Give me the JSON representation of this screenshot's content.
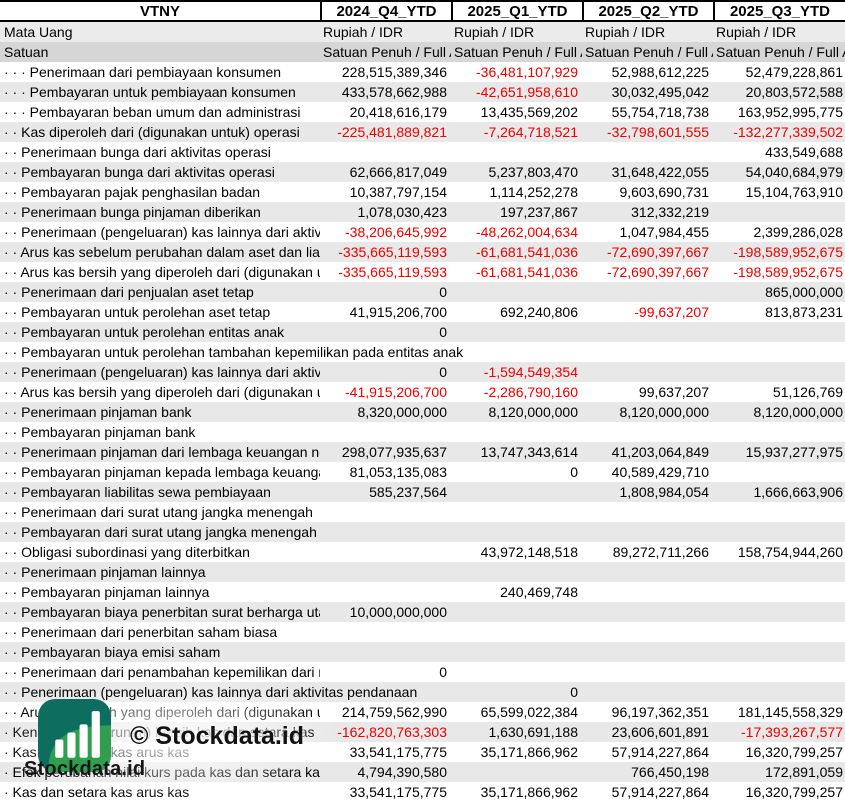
{
  "header": {
    "company": "VTNY",
    "periods": [
      "2024_Q4_YTD",
      "2025_Q1_YTD",
      "2025_Q2_YTD",
      "2025_Q3_YTD"
    ]
  },
  "meta_rows": [
    {
      "label": "Mata Uang",
      "values": [
        "Rupiah / IDR",
        "Rupiah / IDR",
        "Rupiah / IDR",
        "Rupiah / IDR"
      ],
      "style": "meta1"
    },
    {
      "label": "Satuan",
      "values": [
        "Satuan Penuh / Full A",
        "Satuan Penuh / Full A",
        "Satuan Penuh / Full A",
        "Satuan Penuh / Full A"
      ],
      "style": "meta2"
    }
  ],
  "rows": [
    {
      "label": "· · · Penerimaan dari pembiayaan konsumen",
      "values": [
        "228,515,389,346",
        "-36,481,107,929",
        "52,988,612,225",
        "52,479,228,861"
      ]
    },
    {
      "label": "· · · Pembayaran untuk pembiayaan konsumen",
      "values": [
        "433,578,662,988",
        "-42,651,958,610",
        "30,032,495,042",
        "20,803,572,588"
      ]
    },
    {
      "label": "· · · Pembayaran beban umum dan administrasi",
      "values": [
        "20,418,616,179",
        "13,435,569,202",
        "55,754,718,738",
        "163,952,995,775"
      ]
    },
    {
      "label": "· · Kas diperoleh dari (digunakan untuk) operasi",
      "values": [
        "-225,481,889,821",
        "-7,264,718,521",
        "-32,798,601,555",
        "-132,277,339,502"
      ]
    },
    {
      "label": "· · Penerimaan bunga dari aktivitas operasi",
      "values": [
        "",
        "",
        "",
        "433,549,688"
      ]
    },
    {
      "label": "· · Pembayaran bunga dari aktivitas operasi",
      "values": [
        "62,666,817,049",
        "5,237,803,470",
        "31,648,422,055",
        "54,040,684,979"
      ]
    },
    {
      "label": "· · Pembayaran pajak penghasilan badan",
      "values": [
        "10,387,797,154",
        "1,114,252,278",
        "9,603,690,731",
        "15,104,763,910"
      ]
    },
    {
      "label": "· · Penerimaan bunga pinjaman diberikan",
      "values": [
        "1,078,030,423",
        "197,237,867",
        "312,332,219",
        ""
      ]
    },
    {
      "label": "· · Penerimaan (pengeluaran) kas lainnya dari aktivit",
      "values": [
        "-38,206,645,992",
        "-48,262,004,634",
        "1,047,984,455",
        "2,399,286,028"
      ]
    },
    {
      "label": "· · Arus kas sebelum perubahan dalam aset dan liabi",
      "values": [
        "-335,665,119,593",
        "-61,681,541,036",
        "-72,690,397,667",
        "-198,589,952,675"
      ]
    },
    {
      "label": "· · Arus kas bersih yang diperoleh dari (digunakan ur",
      "values": [
        "-335,665,119,593",
        "-61,681,541,036",
        "-72,690,397,667",
        "-198,589,952,675"
      ]
    },
    {
      "label": "· · Penerimaan dari penjualan aset tetap",
      "values": [
        "0",
        "",
        "",
        "865,000,000"
      ]
    },
    {
      "label": "· · Pembayaran untuk perolehan aset tetap",
      "values": [
        "41,915,206,700",
        "692,240,806",
        "-99,637,207",
        "813,873,231"
      ]
    },
    {
      "label": "· · Pembayaran untuk perolehan entitas anak",
      "values": [
        "0",
        "",
        "",
        ""
      ]
    },
    {
      "label": "· · Pembayaran untuk perolehan tambahan kepemilikan pada entitas anak",
      "values": [
        "",
        "",
        "",
        ""
      ]
    },
    {
      "label": "· · Penerimaan (pengeluaran) kas lainnya dari aktivit",
      "values": [
        "0",
        "-1,594,549,354",
        "",
        ""
      ]
    },
    {
      "label": "· · Arus kas bersih yang diperoleh dari (digunakan u",
      "values": [
        "-41,915,206,700",
        "-2,286,790,160",
        "99,637,207",
        "51,126,769"
      ]
    },
    {
      "label": "· · Penerimaan pinjaman bank",
      "values": [
        "8,320,000,000",
        "8,120,000,000",
        "8,120,000,000",
        "8,120,000,000"
      ]
    },
    {
      "label": "· · Pembayaran pinjaman bank",
      "values": [
        "",
        "",
        "",
        ""
      ]
    },
    {
      "label": "· · Penerimaan pinjaman dari lembaga keuangan non",
      "values": [
        "298,077,935,637",
        "13,747,343,614",
        "41,203,064,849",
        "15,937,277,975"
      ]
    },
    {
      "label": "· · Pembayaran pinjaman kepada lembaga keuangan",
      "values": [
        "81,053,135,083",
        "0",
        "40,589,429,710",
        ""
      ]
    },
    {
      "label": "· · Pembayaran liabilitas sewa pembiayaan",
      "values": [
        "585,237,564",
        "",
        "1,808,984,054",
        "1,666,663,906"
      ]
    },
    {
      "label": "· · Penerimaan dari surat utang jangka menengah",
      "values": [
        "",
        "",
        "",
        ""
      ]
    },
    {
      "label": "· · Pembayaran dari surat utang jangka menengah",
      "values": [
        "",
        "",
        "",
        ""
      ]
    },
    {
      "label": "· · Obligasi subordinasi yang diterbitkan",
      "values": [
        "",
        "43,972,148,518",
        "89,272,711,266",
        "158,754,944,260"
      ]
    },
    {
      "label": "· · Penerimaan pinjaman lainnya",
      "values": [
        "",
        "",
        "",
        ""
      ]
    },
    {
      "label": "· · Pembayaran pinjaman lainnya",
      "values": [
        "",
        "240,469,748",
        "",
        ""
      ]
    },
    {
      "label": "· · Pembayaran biaya penerbitan surat berharga utan",
      "values": [
        "10,000,000,000",
        "",
        "",
        ""
      ]
    },
    {
      "label": "· · Penerimaan dari penerbitan saham biasa",
      "values": [
        "",
        "",
        "",
        ""
      ]
    },
    {
      "label": "· · Pembayaran biaya emisi saham",
      "values": [
        "",
        "",
        "",
        ""
      ]
    },
    {
      "label": "· · Penerimaan dari penambahan kepemilikan dari n",
      "values": [
        "0",
        "",
        "",
        ""
      ]
    },
    {
      "label": "· · Penerimaan (pengeluaran) kas lainnya dari aktivitas pendanaan",
      "values": [
        "",
        "0",
        "",
        ""
      ]
    },
    {
      "label": "· · Arus kas bersih yang diperoleh dari (digunakan ur",
      "values": [
        "214,759,562,990",
        "65,599,022,384",
        "96,197,362,351",
        "181,145,558,329"
      ]
    },
    {
      "label": "· Kenaikan (penurunan) bersih kas dan setara kas",
      "values": [
        "-162,820,763,303",
        "1,630,691,188",
        "23,606,601,891",
        "-17,393,267,577"
      ]
    },
    {
      "label": "· Kas dan setara kas arus kas",
      "values": [
        "33,541,175,775",
        "35,171,866,962",
        "57,914,227,864",
        "16,320,799,257"
      ]
    },
    {
      "label": "· Efek perubahan nilai kurs pada kas dan setara kas",
      "values": [
        "4,794,390,580",
        "",
        "766,450,198",
        "172,891,059"
      ]
    },
    {
      "label": "· Kas dan setara kas arus kas",
      "values": [
        "33,541,175,775",
        "35,171,866,962",
        "57,914,227,864",
        "16,320,799,257"
      ]
    }
  ],
  "watermark": {
    "logo_text": "Stockdata.id",
    "copyright_text": "© Stockdata.id"
  },
  "colors": {
    "negative_value": "#e80000",
    "row_stripe": "#e8e8e8",
    "mata_uang_row_bg": "#ebebeb",
    "satuan_row_bg": "#d6d6d6",
    "logo_teal": "#0d6e60",
    "logo_green": "#2f9e4f"
  },
  "icons": {
    "logo": "bar-chart-icon"
  }
}
